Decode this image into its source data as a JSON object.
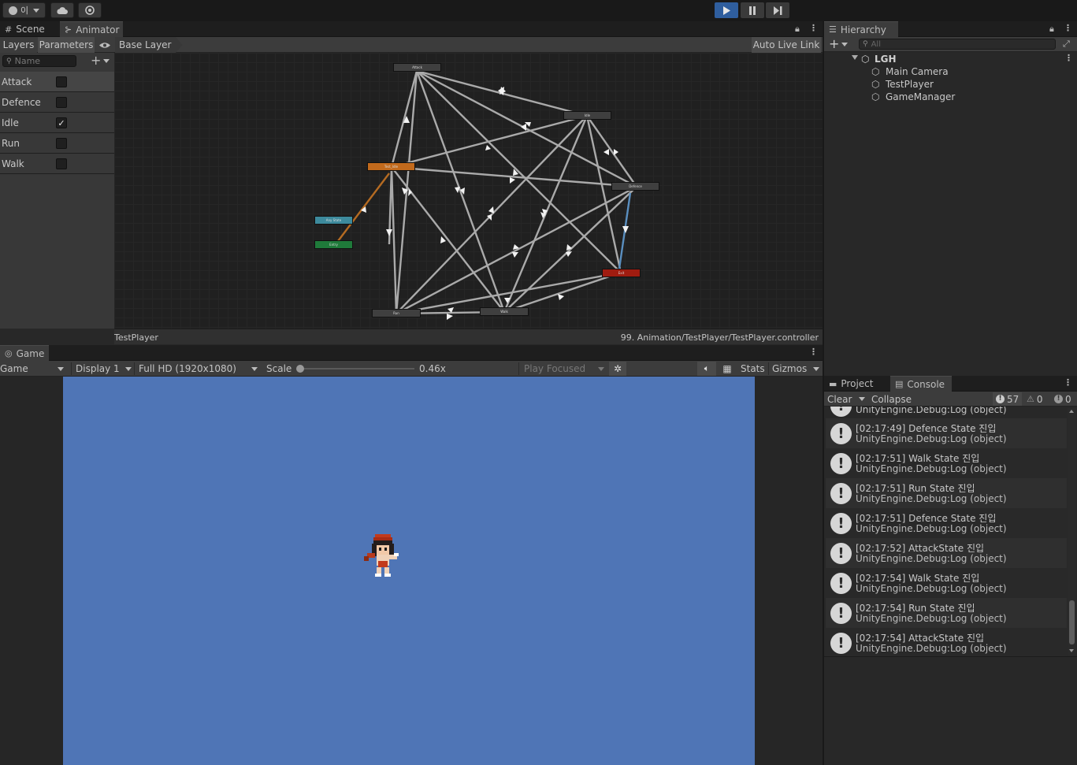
{
  "toolbar": {
    "account_label": "이",
    "play_color": "#2f5e9e"
  },
  "animator": {
    "tabs": {
      "scene": "Scene",
      "animator": "Animator"
    },
    "subtabs": {
      "layers": "Layers",
      "parameters": "Parameters"
    },
    "breadcrumb": "Base Layer",
    "auto_live_link": "Auto Live Link",
    "search_placeholder": "Name",
    "parameters": [
      {
        "name": "Attack",
        "checked": false
      },
      {
        "name": "Defence",
        "checked": false
      },
      {
        "name": "Idle",
        "checked": true
      },
      {
        "name": "Run",
        "checked": false
      },
      {
        "name": "Walk",
        "checked": false
      }
    ],
    "footer_left": "TestPlayer",
    "footer_right": "99. Animation/TestPlayer/TestPlayer.controller",
    "graph": {
      "states": [
        {
          "name": "Attack",
          "color": "#3f3f3f"
        },
        {
          "name": "Idle",
          "color": "#3f3f3f"
        },
        {
          "name": "Defence",
          "color": "#3f3f3f"
        },
        {
          "name": "Test_Idle",
          "color": "#c26a1c"
        },
        {
          "name": "Any State",
          "color": "#3d8a9c"
        },
        {
          "name": "Entry",
          "color": "#1f7a3a"
        },
        {
          "name": "Exit",
          "color": "#a01c10"
        },
        {
          "name": "Run",
          "color": "#3f3f3f"
        },
        {
          "name": "Walk",
          "color": "#3f3f3f"
        }
      ]
    }
  },
  "hierarchy": {
    "tab": "Hierarchy",
    "search_placeholder": "All",
    "scene": "LGH",
    "items": [
      "Main Camera",
      "TestPlayer",
      "GameManager"
    ]
  },
  "game": {
    "tab": "Game",
    "mode": "Game",
    "display": "Display 1",
    "resolution": "Full HD (1920x1080)",
    "scale_label": "Scale",
    "scale_value": "0.46x",
    "scale_fraction": 0.0,
    "play_focused": "Play Focused",
    "stats": "Stats",
    "gizmos": "Gizmos",
    "background": "#4f75b6"
  },
  "console": {
    "tabs": {
      "project": "Project",
      "console": "Console"
    },
    "clear": "Clear",
    "collapse": "Collapse",
    "counts": {
      "log": "57",
      "warn": "0",
      "error": "0"
    },
    "partial_top": "UnityEngine.Debug:Log (object)",
    "entries": [
      {
        "message": "[02:17:49] Defence State 진입",
        "source": "UnityEngine.Debug:Log (object)"
      },
      {
        "message": "[02:17:51] Walk State 진입",
        "source": "UnityEngine.Debug:Log (object)"
      },
      {
        "message": "[02:17:51] Run State 진입",
        "source": "UnityEngine.Debug:Log (object)"
      },
      {
        "message": "[02:17:51] Defence State 진입",
        "source": "UnityEngine.Debug:Log (object)"
      },
      {
        "message": "[02:17:52] AttackState 진입",
        "source": "UnityEngine.Debug:Log (object)"
      },
      {
        "message": "[02:17:54] Walk State 진입",
        "source": "UnityEngine.Debug:Log (object)"
      },
      {
        "message": "[02:17:54] Run State 진입",
        "source": "UnityEngine.Debug:Log (object)"
      },
      {
        "message": "[02:17:54] AttackState 진입",
        "source": "UnityEngine.Debug:Log (object)"
      }
    ]
  }
}
